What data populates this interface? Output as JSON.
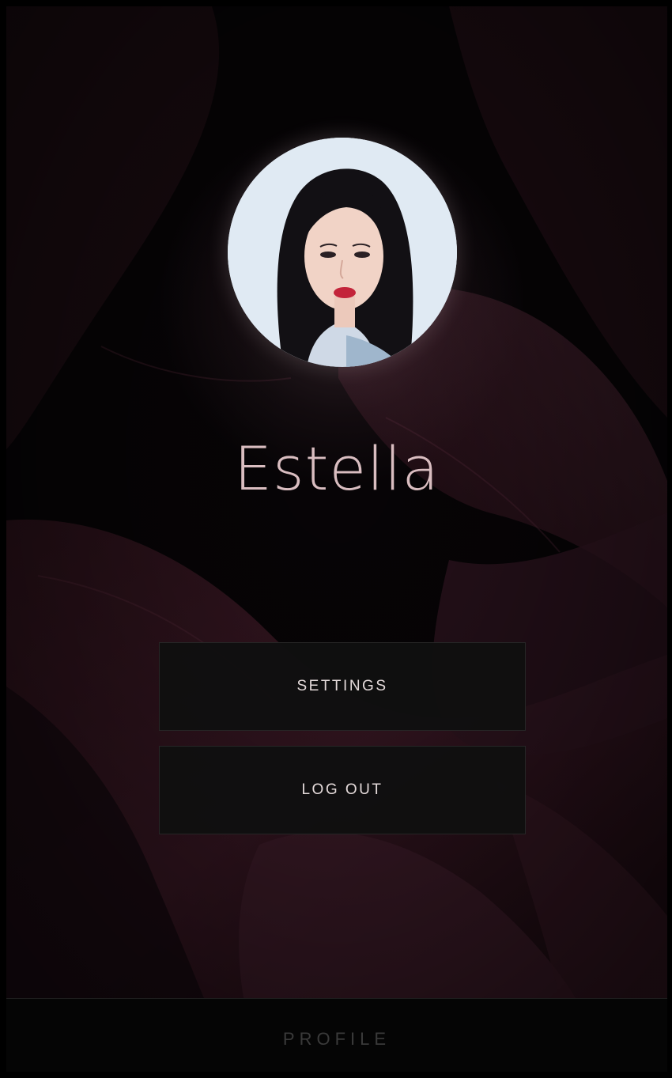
{
  "profile": {
    "name": "Estella",
    "avatar_icon": "profile-photo"
  },
  "menu": {
    "settings_label": "SETTINGS",
    "logout_label": "LOG OUT"
  },
  "footer": {
    "title": "PROFILE"
  },
  "colors": {
    "background": "#060406",
    "silk": "#3a1a26",
    "name_text": "#d9bdc0",
    "button_bg": "#101010",
    "button_text": "#e4dada",
    "footer_text": "#3a3a3a"
  }
}
